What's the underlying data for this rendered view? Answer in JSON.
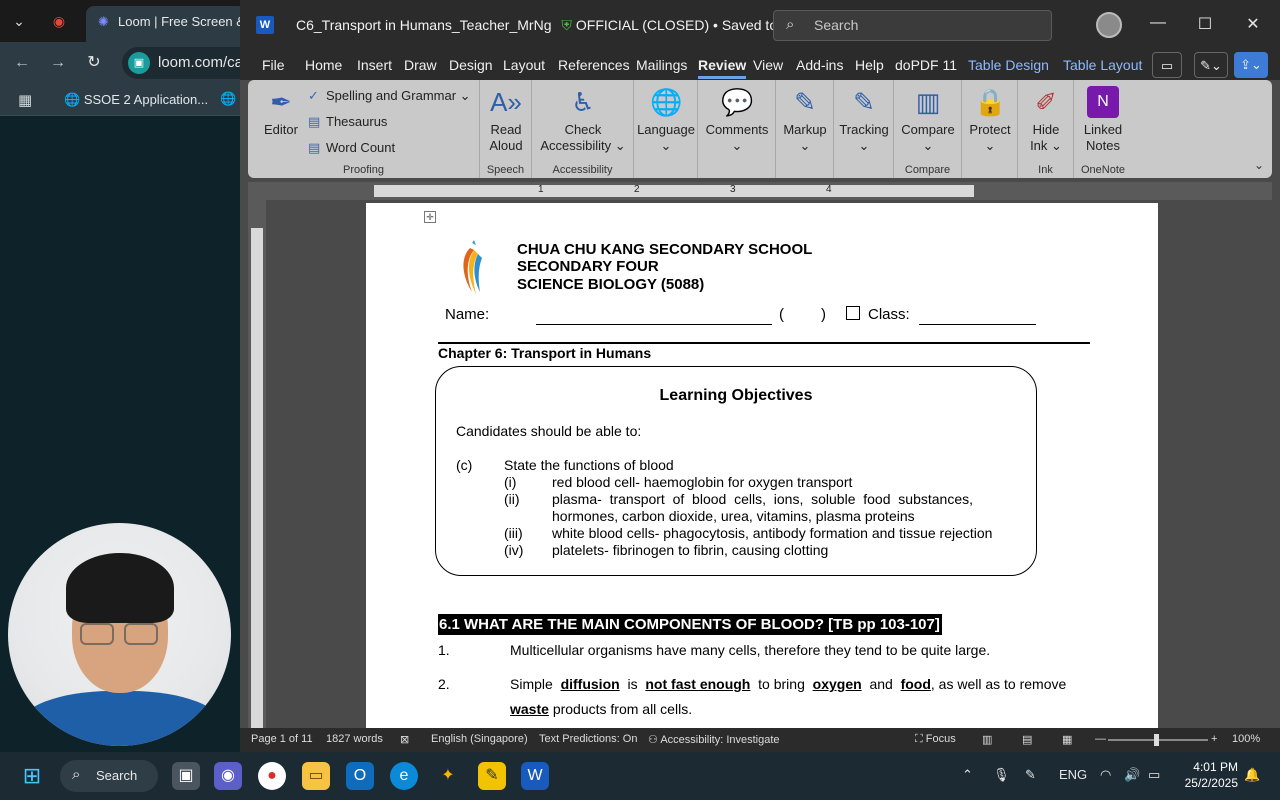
{
  "browser": {
    "tab_title": "Loom | Free Screen & V",
    "address": "loom.com/ca",
    "bookmark": "SSOE 2 Application..."
  },
  "word": {
    "title": "C6_Transport in Humans_Teacher_MrNg",
    "classification": "OFFICIAL (CLOSED)",
    "save_status": "• Saved to S: Drive",
    "search_placeholder": "Search",
    "menu": [
      "File",
      "Home",
      "Insert",
      "Draw",
      "Design",
      "Layout",
      "References",
      "Mailings",
      "Review",
      "View",
      "Add-ins",
      "Help",
      "doPDF 11",
      "Table Design",
      "Table Layout"
    ],
    "active_menu": "Review",
    "ribbon": {
      "proofing": {
        "label": "Proofing",
        "editor": "Editor",
        "spelling": "Spelling and Grammar",
        "thesaurus": "Thesaurus",
        "word_count": "Word Count"
      },
      "speech": {
        "label": "Speech",
        "read_aloud_1": "Read",
        "read_aloud_2": "Aloud"
      },
      "accessibility": {
        "label": "Accessibility",
        "check_1": "Check",
        "check_2": "Accessibility"
      },
      "language": {
        "label": "Language"
      },
      "comments": {
        "label": "Comments"
      },
      "markup": {
        "label": "Markup"
      },
      "tracking": {
        "label": "Tracking"
      },
      "compare": {
        "label": "Compare",
        "button": "Compare"
      },
      "protect": {
        "label": "Protect"
      },
      "ink": {
        "label": "Ink",
        "hide_1": "Hide",
        "hide_2": "Ink"
      },
      "onenote": {
        "label": "OneNote",
        "linked_1": "Linked",
        "linked_2": "Notes"
      }
    },
    "ruler_numbers": [
      "1",
      "2",
      "3",
      "4"
    ],
    "vruler_numbers": [
      "1",
      "2",
      "3",
      "4",
      "5"
    ],
    "status": {
      "page": "Page 1 of 11",
      "words": "1827 words",
      "language": "English (Singapore)",
      "predictions": "Text Predictions: On",
      "accessibility": "Accessibility: Investigate",
      "focus": "Focus",
      "zoom": "100%"
    }
  },
  "document": {
    "school": "CHUA CHU KANG SECONDARY SCHOOL",
    "level": "SECONDARY FOUR",
    "subject": "SCIENCE BIOLOGY (5088)",
    "name_label": "Name:",
    "paren_open": "(",
    "paren_close": ")",
    "class_label": "Class:",
    "chapter": "Chapter 6: Transport in Humans",
    "lo_title": "Learning Objectives",
    "lo_intro": "Candidates should be able to:",
    "lo_c_marker": "(c)",
    "lo_c_text": "State the functions of blood",
    "lo_items": [
      {
        "marker": "(i)",
        "text": "red blood cell- haemoglobin for oxygen transport"
      },
      {
        "marker": "(ii)",
        "text": "plasma-  transport  of  blood  cells,  ions,  soluble  food  substances,"
      },
      {
        "marker": "",
        "text": "hormones, carbon dioxide, urea, vitamins, plasma proteins"
      },
      {
        "marker": "(iii)",
        "text": "white blood cells- phagocytosis, antibody formation and tissue rejection"
      },
      {
        "marker": "(iv)",
        "text": "platelets- fibrinogen to fibrin, causing clotting"
      }
    ],
    "section_heading": "6.1 WHAT ARE THE MAIN COMPONENTS OF BLOOD? [TB pp 103-107]",
    "p1_num": "1.",
    "p1_text": "Multicellular organisms have many cells, therefore they tend to be quite large.",
    "p2_num": "2.",
    "p2_a": "Simple",
    "p2_b": "diffusion",
    "p2_c": "is",
    "p2_d": "not fast enough",
    "p2_e": "to bring",
    "p2_f": "oxygen",
    "p2_g": "and",
    "p2_h": "food",
    "p2_i": ", as well as to remove",
    "p2_j": "waste",
    "p2_k": "products from all cells."
  },
  "taskbar": {
    "search": "Search",
    "lang": "ENG",
    "time": "4:01 PM",
    "date": "25/2/2025"
  }
}
